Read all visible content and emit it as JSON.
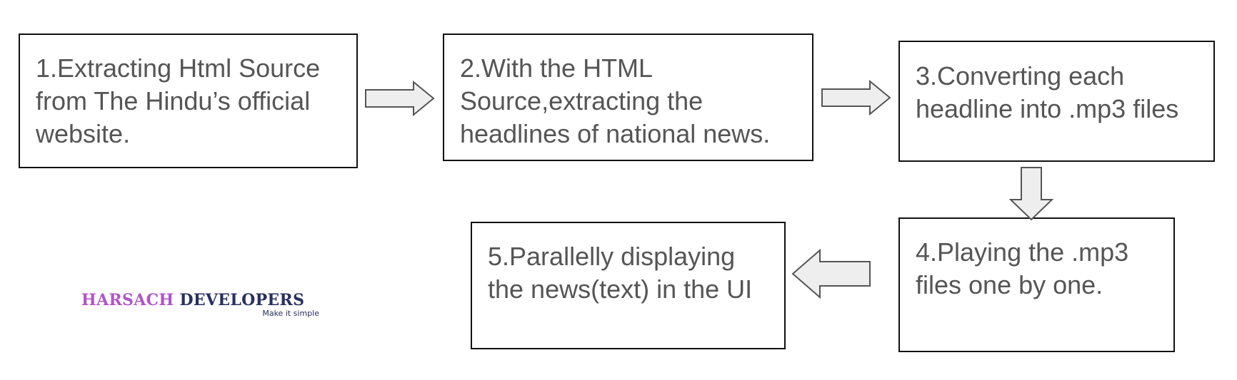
{
  "steps": [
    {
      "text": "1.Extracting Html Source\nfrom The Hindu’s official\nwebsite."
    },
    {
      "text": "2.With the HTML\nSource,extracting the\nheadlines of national news."
    },
    {
      "text": "3.Converting each\nheadline into .mp3 files"
    },
    {
      "text": "4.Playing the .mp3\nfiles one by one."
    },
    {
      "text": "5.Parallelly displaying\nthe news(text) in the UI"
    }
  ],
  "logo": {
    "name_first": "HARSACH",
    "name_second": "DEVELOPERS",
    "tagline": "Make it simple"
  },
  "colors": {
    "box_border": "#111111",
    "box_text": "#555555",
    "arrow_fill": "#eeeeee",
    "arrow_stroke": "#555555",
    "logo_first": "#b154c9",
    "logo_second": "#27305f"
  },
  "connections": [
    {
      "from": 1,
      "to": 2,
      "direction": "right"
    },
    {
      "from": 2,
      "to": 3,
      "direction": "right"
    },
    {
      "from": 3,
      "to": 4,
      "direction": "down"
    },
    {
      "from": 4,
      "to": 5,
      "direction": "left"
    }
  ]
}
